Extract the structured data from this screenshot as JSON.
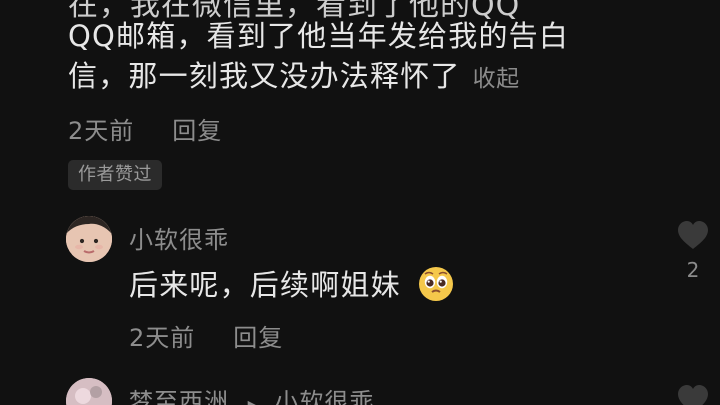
{
  "main_comment": {
    "cropped_top_text": "在，我在微信里，看到了他的QQ",
    "text": "QQ邮箱，看到了他当年发给我的告白信，那一刻我又没办法释怀了",
    "collapse_label": "收起",
    "time": "2天前",
    "reply_label": "回复",
    "author_liked_badge": "作者赞过"
  },
  "replies": [
    {
      "username": "小软很乖",
      "text": "后来呢，后续啊姐妹",
      "emoji": "pleading-face-emoji",
      "time": "2天前",
      "reply_label": "回复",
      "like_count": "2"
    },
    {
      "username": "梦至西洲",
      "reply_arrow": "▸",
      "reply_to": "小软很乖"
    }
  ],
  "colors": {
    "background": "#111111",
    "primary_text": "#e7e7e7",
    "secondary_text": "#8d8d8d",
    "badge_background": "#2b2b2b"
  }
}
